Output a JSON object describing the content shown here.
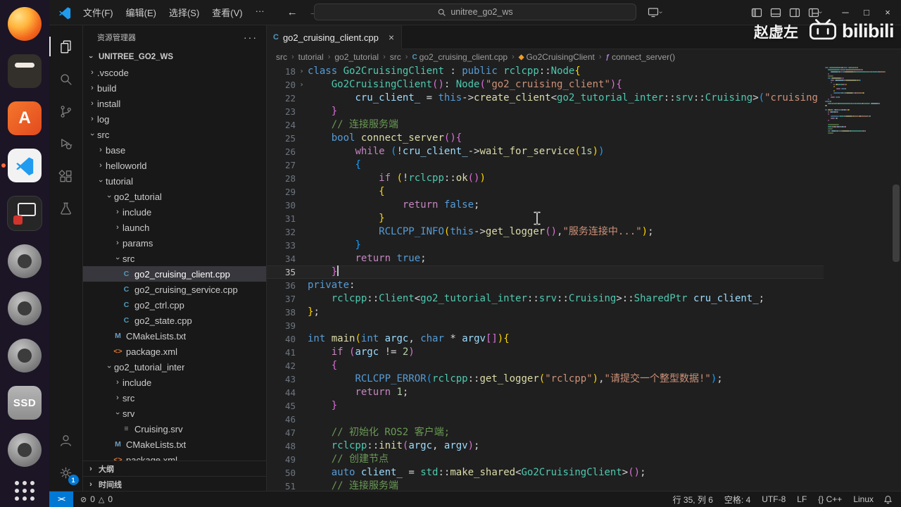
{
  "colors": {
    "accent": "#0078d4",
    "remote_bg": "#0078d4",
    "kw": "#569cd6",
    "ctrl": "#c586c0",
    "type": "#4ec9b0",
    "fn": "#dcdcaa",
    "var": "#9cdcfe",
    "str": "#ce9178",
    "num": "#b5cea8",
    "cmt": "#6a9955",
    "pn": "#d4d4d4",
    "macro": "#569cd6",
    "b1": "#ffd700",
    "b2": "#da70d6",
    "b3": "#179fff"
  },
  "dock": {
    "items": [
      {
        "name": "firefox",
        "kind": "firefox"
      },
      {
        "name": "dark-app",
        "kind": "tile-dark"
      },
      {
        "name": "orange-app",
        "kind": "tile-orange",
        "letter": "A"
      },
      {
        "name": "vscode",
        "kind": "vscode",
        "active": true
      },
      {
        "name": "recorder-app",
        "kind": "tile-recorder"
      },
      {
        "name": "gray-app-1",
        "kind": "circle"
      },
      {
        "name": "gray-app-2",
        "kind": "circle"
      },
      {
        "name": "gray-app-3",
        "kind": "circle"
      },
      {
        "name": "ssd-drive",
        "kind": "ssd",
        "label": "SSD"
      },
      {
        "name": "gray-app-4",
        "kind": "circle"
      },
      {
        "name": "show-apps",
        "kind": "grid"
      }
    ]
  },
  "titlebar": {
    "menus": [
      "文件(F)",
      "编辑(E)",
      "选择(S)",
      "查看(V)",
      "···"
    ],
    "search": "unitree_go2_ws"
  },
  "watermark": {
    "name": "赵虚左",
    "brand": "bilibili"
  },
  "activitybar": {
    "items": [
      {
        "name": "explorer",
        "active": true
      },
      {
        "name": "search"
      },
      {
        "name": "source-control"
      },
      {
        "name": "run-debug"
      },
      {
        "name": "extensions"
      },
      {
        "name": "testing"
      }
    ],
    "bottom": [
      {
        "name": "account"
      },
      {
        "name": "settings",
        "badge": "1"
      }
    ]
  },
  "sidebar": {
    "title": "资源管理器",
    "actions_label": "···",
    "root": "UNITREE_GO2_WS",
    "outline_label": "大纲",
    "timeline_label": "时间线",
    "tree": [
      {
        "d": 0,
        "k": "folder",
        "state": "collapsed",
        "label": ".vscode"
      },
      {
        "d": 0,
        "k": "folder",
        "state": "collapsed",
        "label": "build"
      },
      {
        "d": 0,
        "k": "folder",
        "state": "collapsed",
        "label": "install"
      },
      {
        "d": 0,
        "k": "folder",
        "state": "collapsed",
        "label": "log"
      },
      {
        "d": 0,
        "k": "folder",
        "state": "expanded",
        "label": "src"
      },
      {
        "d": 1,
        "k": "folder",
        "state": "collapsed",
        "label": "base"
      },
      {
        "d": 1,
        "k": "folder",
        "state": "collapsed",
        "label": "helloworld"
      },
      {
        "d": 1,
        "k": "folder",
        "state": "expanded",
        "label": "tutorial"
      },
      {
        "d": 2,
        "k": "folder",
        "state": "expanded",
        "label": "go2_tutorial"
      },
      {
        "d": 3,
        "k": "folder",
        "state": "collapsed",
        "label": "include"
      },
      {
        "d": 3,
        "k": "folder",
        "state": "collapsed",
        "label": "launch"
      },
      {
        "d": 3,
        "k": "folder",
        "state": "collapsed",
        "label": "params"
      },
      {
        "d": 3,
        "k": "folder",
        "state": "expanded",
        "label": "src"
      },
      {
        "d": 4,
        "k": "file",
        "icon": "cpp",
        "label": "go2_cruising_client.cpp",
        "selected": true
      },
      {
        "d": 4,
        "k": "file",
        "icon": "cpp",
        "label": "go2_cruising_service.cpp"
      },
      {
        "d": 4,
        "k": "file",
        "icon": "cpp",
        "label": "go2_ctrl.cpp"
      },
      {
        "d": 4,
        "k": "file",
        "icon": "cpp",
        "label": "go2_state.cpp"
      },
      {
        "d": 3,
        "k": "file",
        "icon": "cmake",
        "label": "CMakeLists.txt"
      },
      {
        "d": 3,
        "k": "file",
        "icon": "xml",
        "label": "package.xml"
      },
      {
        "d": 2,
        "k": "folder",
        "state": "expanded",
        "label": "go2_tutorial_inter"
      },
      {
        "d": 3,
        "k": "folder",
        "state": "collapsed",
        "label": "include"
      },
      {
        "d": 3,
        "k": "folder",
        "state": "collapsed",
        "label": "src"
      },
      {
        "d": 3,
        "k": "folder",
        "state": "expanded",
        "label": "srv"
      },
      {
        "d": 4,
        "k": "file",
        "icon": "srv",
        "label": "Cruising.srv"
      },
      {
        "d": 3,
        "k": "file",
        "icon": "cmake",
        "label": "CMakeLists.txt"
      },
      {
        "d": 3,
        "k": "file",
        "icon": "xml",
        "label": "package.xml"
      }
    ]
  },
  "editor": {
    "tab_label": "go2_cruising_client.cpp",
    "tab_icon": "cpp",
    "breadcrumbs": [
      {
        "label": "src"
      },
      {
        "label": "tutorial"
      },
      {
        "label": "go2_tutorial"
      },
      {
        "label": "src"
      },
      {
        "label": "go2_cruising_client.cpp",
        "icon": "cpp"
      },
      {
        "label": "Go2CruisingClient",
        "icon": "class"
      },
      {
        "label": "connect_server()",
        "icon": "method"
      }
    ],
    "cursor": {
      "line": 35,
      "col": 6
    },
    "lines": [
      {
        "n": 18,
        "fold": true,
        "t": [
          [
            "kw",
            "class"
          ],
          [
            "pn",
            " "
          ],
          [
            "type",
            "Go2CruisingClient"
          ],
          [
            "pn",
            " : "
          ],
          [
            "kw",
            "public"
          ],
          [
            "pn",
            " "
          ],
          [
            "type",
            "rclcpp"
          ],
          [
            "pn",
            "::"
          ],
          [
            "type",
            "Node"
          ],
          [
            "b1",
            "{"
          ]
        ]
      },
      {
        "n": 20,
        "fold": true,
        "t": [
          [
            "pn",
            "    "
          ],
          [
            "type",
            "Go2CruisingClient"
          ],
          [
            "b2",
            "()"
          ],
          [
            "pn",
            ": "
          ],
          [
            "type",
            "Node"
          ],
          [
            "b2",
            "("
          ],
          [
            "str",
            "\"go2_cruising_client\""
          ],
          [
            "b2",
            ")"
          ],
          [
            "b2",
            "{"
          ]
        ]
      },
      {
        "n": 22,
        "t": [
          [
            "pn",
            "        "
          ],
          [
            "var",
            "cru_client_"
          ],
          [
            "pn",
            " = "
          ],
          [
            "kw",
            "this"
          ],
          [
            "pn",
            "->"
          ],
          [
            "fn",
            "create_client"
          ],
          [
            "pn",
            "<"
          ],
          [
            "type",
            "go2_tutorial_inter"
          ],
          [
            "pn",
            "::"
          ],
          [
            "type",
            "srv"
          ],
          [
            "pn",
            "::"
          ],
          [
            "type",
            "Cruising"
          ],
          [
            "pn",
            ">"
          ],
          [
            "b3",
            "("
          ],
          [
            "str",
            "\"cruising"
          ]
        ]
      },
      {
        "n": 23,
        "t": [
          [
            "pn",
            "    "
          ],
          [
            "b2",
            "}"
          ]
        ]
      },
      {
        "n": 24,
        "t": [
          [
            "pn",
            "    "
          ],
          [
            "cmt",
            "// 连接服务端"
          ]
        ]
      },
      {
        "n": 25,
        "t": [
          [
            "pn",
            "    "
          ],
          [
            "kw",
            "bool"
          ],
          [
            "pn",
            " "
          ],
          [
            "fn",
            "connect_server"
          ],
          [
            "b2",
            "()"
          ],
          [
            "b2",
            "{"
          ]
        ]
      },
      {
        "n": 26,
        "t": [
          [
            "pn",
            "        "
          ],
          [
            "ctrl",
            "while"
          ],
          [
            "pn",
            " "
          ],
          [
            "b3",
            "("
          ],
          [
            "pn",
            "!"
          ],
          [
            "var",
            "cru_client_"
          ],
          [
            "pn",
            "->"
          ],
          [
            "fn",
            "wait_for_service"
          ],
          [
            "b1",
            "("
          ],
          [
            "num",
            "1s"
          ],
          [
            "b1",
            ")"
          ],
          [
            "b3",
            ")"
          ]
        ]
      },
      {
        "n": 27,
        "t": [
          [
            "pn",
            "        "
          ],
          [
            "b3",
            "{"
          ]
        ]
      },
      {
        "n": 28,
        "t": [
          [
            "pn",
            "            "
          ],
          [
            "ctrl",
            "if"
          ],
          [
            "pn",
            " "
          ],
          [
            "b1",
            "("
          ],
          [
            "pn",
            "!"
          ],
          [
            "type",
            "rclcpp"
          ],
          [
            "pn",
            "::"
          ],
          [
            "fn",
            "ok"
          ],
          [
            "b2",
            "()"
          ],
          [
            "b1",
            ")"
          ]
        ]
      },
      {
        "n": 29,
        "t": [
          [
            "pn",
            "            "
          ],
          [
            "b1",
            "{"
          ]
        ]
      },
      {
        "n": 30,
        "t": [
          [
            "pn",
            "                "
          ],
          [
            "ctrl",
            "return"
          ],
          [
            "pn",
            " "
          ],
          [
            "kw",
            "false"
          ],
          [
            "pn",
            ";"
          ]
        ]
      },
      {
        "n": 31,
        "t": [
          [
            "pn",
            "            "
          ],
          [
            "b1",
            "}"
          ]
        ]
      },
      {
        "n": 32,
        "t": [
          [
            "pn",
            "            "
          ],
          [
            "macro",
            "RCLCPP_INFO"
          ],
          [
            "b1",
            "("
          ],
          [
            "kw",
            "this"
          ],
          [
            "pn",
            "->"
          ],
          [
            "fn",
            "get_logger"
          ],
          [
            "b2",
            "()"
          ],
          [
            "pn",
            ","
          ],
          [
            "str",
            "\"服务连接中...\""
          ],
          [
            "b1",
            ")"
          ],
          [
            "pn",
            ";"
          ]
        ]
      },
      {
        "n": 33,
        "t": [
          [
            "pn",
            "        "
          ],
          [
            "b3",
            "}"
          ]
        ]
      },
      {
        "n": 34,
        "t": [
          [
            "pn",
            "        "
          ],
          [
            "ctrl",
            "return"
          ],
          [
            "pn",
            " "
          ],
          [
            "kw",
            "true"
          ],
          [
            "pn",
            ";"
          ]
        ]
      },
      {
        "n": 35,
        "t": [
          [
            "pn",
            "    "
          ],
          [
            "b2",
            "}"
          ]
        ]
      },
      {
        "n": 36,
        "t": [
          [
            "kw",
            "private"
          ],
          [
            "pn",
            ":"
          ]
        ]
      },
      {
        "n": 37,
        "t": [
          [
            "pn",
            "    "
          ],
          [
            "type",
            "rclcpp"
          ],
          [
            "pn",
            "::"
          ],
          [
            "type",
            "Client"
          ],
          [
            "pn",
            "<"
          ],
          [
            "type",
            "go2_tutorial_inter"
          ],
          [
            "pn",
            "::"
          ],
          [
            "type",
            "srv"
          ],
          [
            "pn",
            "::"
          ],
          [
            "type",
            "Cruising"
          ],
          [
            "pn",
            ">::"
          ],
          [
            "type",
            "SharedPtr"
          ],
          [
            "pn",
            " "
          ],
          [
            "var",
            "cru_client_"
          ],
          [
            "pn",
            ";"
          ]
        ]
      },
      {
        "n": 38,
        "t": [
          [
            "b1",
            "}"
          ],
          [
            "pn",
            ";"
          ]
        ]
      },
      {
        "n": 39,
        "t": []
      },
      {
        "n": 40,
        "t": [
          [
            "kw",
            "int"
          ],
          [
            "pn",
            " "
          ],
          [
            "fn",
            "main"
          ],
          [
            "b1",
            "("
          ],
          [
            "kw",
            "int"
          ],
          [
            "pn",
            " "
          ],
          [
            "var",
            "argc"
          ],
          [
            "pn",
            ", "
          ],
          [
            "kw",
            "char"
          ],
          [
            "pn",
            " * "
          ],
          [
            "var",
            "argv"
          ],
          [
            "b2",
            "[]"
          ],
          [
            "b1",
            ")"
          ],
          [
            "b1",
            "{"
          ]
        ]
      },
      {
        "n": 41,
        "t": [
          [
            "pn",
            "    "
          ],
          [
            "ctrl",
            "if"
          ],
          [
            "pn",
            " "
          ],
          [
            "b2",
            "("
          ],
          [
            "var",
            "argc"
          ],
          [
            "pn",
            " != "
          ],
          [
            "num",
            "2"
          ],
          [
            "b2",
            ")"
          ]
        ]
      },
      {
        "n": 42,
        "t": [
          [
            "pn",
            "    "
          ],
          [
            "b2",
            "{"
          ]
        ]
      },
      {
        "n": 43,
        "t": [
          [
            "pn",
            "        "
          ],
          [
            "macro",
            "RCLCPP_ERROR"
          ],
          [
            "b3",
            "("
          ],
          [
            "type",
            "rclcpp"
          ],
          [
            "pn",
            "::"
          ],
          [
            "fn",
            "get_logger"
          ],
          [
            "b1",
            "("
          ],
          [
            "str",
            "\"rclcpp\""
          ],
          [
            "b1",
            ")"
          ],
          [
            "pn",
            ","
          ],
          [
            "str",
            "\"请提交一个整型数据!\""
          ],
          [
            "b3",
            ")"
          ],
          [
            "pn",
            ";"
          ]
        ]
      },
      {
        "n": 44,
        "t": [
          [
            "pn",
            "        "
          ],
          [
            "ctrl",
            "return"
          ],
          [
            "pn",
            " "
          ],
          [
            "num",
            "1"
          ],
          [
            "pn",
            ";"
          ]
        ]
      },
      {
        "n": 45,
        "t": [
          [
            "pn",
            "    "
          ],
          [
            "b2",
            "}"
          ]
        ]
      },
      {
        "n": 46,
        "t": []
      },
      {
        "n": 47,
        "t": [
          [
            "pn",
            "    "
          ],
          [
            "cmt",
            "// 初始化 ROS2 客户端;"
          ]
        ]
      },
      {
        "n": 48,
        "t": [
          [
            "pn",
            "    "
          ],
          [
            "type",
            "rclcpp"
          ],
          [
            "pn",
            "::"
          ],
          [
            "fn",
            "init"
          ],
          [
            "b2",
            "("
          ],
          [
            "var",
            "argc"
          ],
          [
            "pn",
            ", "
          ],
          [
            "var",
            "argv"
          ],
          [
            "b2",
            ")"
          ],
          [
            "pn",
            ";"
          ]
        ]
      },
      {
        "n": 49,
        "t": [
          [
            "pn",
            "    "
          ],
          [
            "cmt",
            "// 创建节点"
          ]
        ]
      },
      {
        "n": 50,
        "t": [
          [
            "pn",
            "    "
          ],
          [
            "kw",
            "auto"
          ],
          [
            "pn",
            " "
          ],
          [
            "var",
            "client_"
          ],
          [
            "pn",
            " = "
          ],
          [
            "type",
            "std"
          ],
          [
            "pn",
            "::"
          ],
          [
            "fn",
            "make_shared"
          ],
          [
            "pn",
            "<"
          ],
          [
            "type",
            "Go2CruisingClient"
          ],
          [
            "pn",
            ">"
          ],
          [
            "b2",
            "()"
          ],
          [
            "pn",
            ";"
          ]
        ]
      },
      {
        "n": 51,
        "t": [
          [
            "pn",
            "    "
          ],
          [
            "cmt",
            "// 连接服务端"
          ]
        ]
      }
    ]
  },
  "statusbar": {
    "remote_label": "><",
    "errors": "0",
    "warnings": "0",
    "items": [
      "行 35, 列 6",
      "空格: 4",
      "UTF-8",
      "LF",
      "{} C++",
      "Linux"
    ]
  }
}
